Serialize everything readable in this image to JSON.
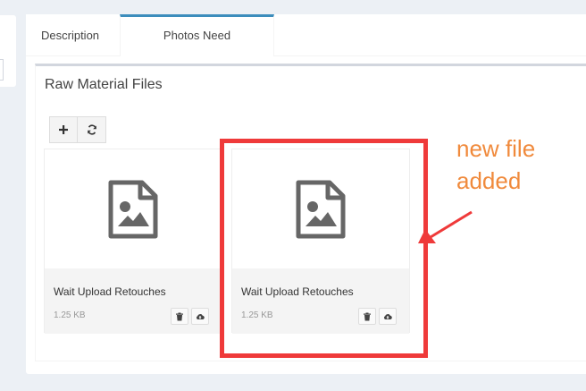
{
  "tabs": [
    {
      "label": "Description"
    },
    {
      "label": "Photos Need Retouched"
    }
  ],
  "box": {
    "title": "Raw Material Files"
  },
  "toolbar": {
    "add_icon": "plus-icon",
    "refresh_icon": "refresh-icon"
  },
  "files": [
    {
      "name": "Wait Upload Retouches",
      "size": "1.25 KB",
      "icon": "image-file-icon"
    },
    {
      "name": "Wait Upload Retouches",
      "size": "1.25 KB",
      "icon": "image-file-icon"
    }
  ],
  "annotation": {
    "line1": "new file",
    "line2": "added",
    "highlight_color": "#ef3a3a",
    "text_color": "#f08a3c"
  },
  "colors": {
    "accent": "#3c8dbc",
    "icon": "#666666"
  }
}
